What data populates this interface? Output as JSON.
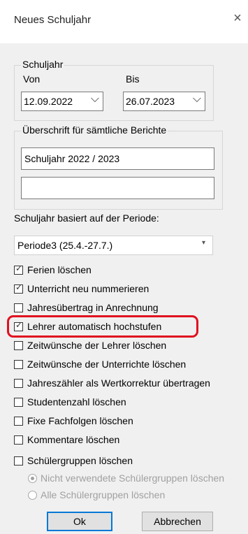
{
  "window": {
    "title": "Neues Schuljahr",
    "close_glyph": "×"
  },
  "schuljahr": {
    "legend": "Schuljahr",
    "von_label": "Von",
    "bis_label": "Bis",
    "von_value": "12.09.2022",
    "bis_value": "26.07.2023",
    "arrow": "⌵"
  },
  "ueberschrift": {
    "legend": "Überschrift für sämtliche Berichte",
    "line1": "Schuljahr 2022 / 2023",
    "line2": ""
  },
  "periode": {
    "label": "Schuljahr basiert auf der Periode:",
    "value": "Periode3 (25.4.-27.7.)",
    "arrow": "▾"
  },
  "options": [
    {
      "label": "Ferien löschen",
      "checked": true
    },
    {
      "label": "Unterricht neu nummerieren",
      "checked": true
    },
    {
      "label": "Jahresübertrag in Anrechnung",
      "checked": false
    },
    {
      "label": "Lehrer automatisch hochstufen",
      "checked": true
    },
    {
      "label": "Zeitwünsche der Lehrer löschen",
      "checked": false
    },
    {
      "label": "Zeitwünsche der Unterrichte löschen",
      "checked": false
    },
    {
      "label": "Jahreszähler als Wertkorrektur übertragen",
      "checked": false
    },
    {
      "label": "Studentenzahl löschen",
      "checked": false
    },
    {
      "label": "Fixe Fachfolgen löschen",
      "checked": false
    },
    {
      "label": "Kommentare löschen",
      "checked": false
    },
    {
      "label": "Schülergruppen löschen",
      "checked": false
    }
  ],
  "radios": [
    {
      "label": "Nicht verwendete Schülergruppen löschen",
      "selected": true
    },
    {
      "label": "Alle Schülergruppen löschen",
      "selected": false
    }
  ],
  "buttons": {
    "ok": "Ok",
    "cancel": "Abbrechen"
  },
  "colors": {
    "highlight": "#e01020",
    "focus": "#0078d7",
    "client_bg": "#f0f0f0"
  }
}
